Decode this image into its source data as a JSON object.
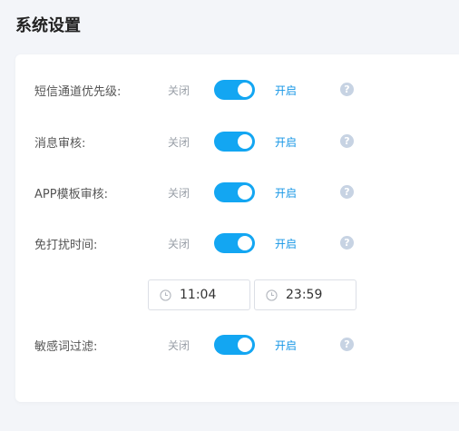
{
  "page": {
    "title": "系统设置"
  },
  "toggle_text": {
    "off": "关闭",
    "on": "开启",
    "help": "?"
  },
  "settings": [
    {
      "label": "短信通道优先级:",
      "enabled": true
    },
    {
      "label": "消息审核:",
      "enabled": true
    },
    {
      "label": "APP模板审核:",
      "enabled": true
    },
    {
      "label": "免打扰时间:",
      "enabled": true
    },
    {
      "label": "敏感词过滤:",
      "enabled": true
    }
  ],
  "dnd_time": {
    "start": "11:04",
    "end": "23:59"
  },
  "colors": {
    "accent": "#13a6f2",
    "on_text": "#1596e6",
    "help_icon": "#c7d3e3"
  }
}
